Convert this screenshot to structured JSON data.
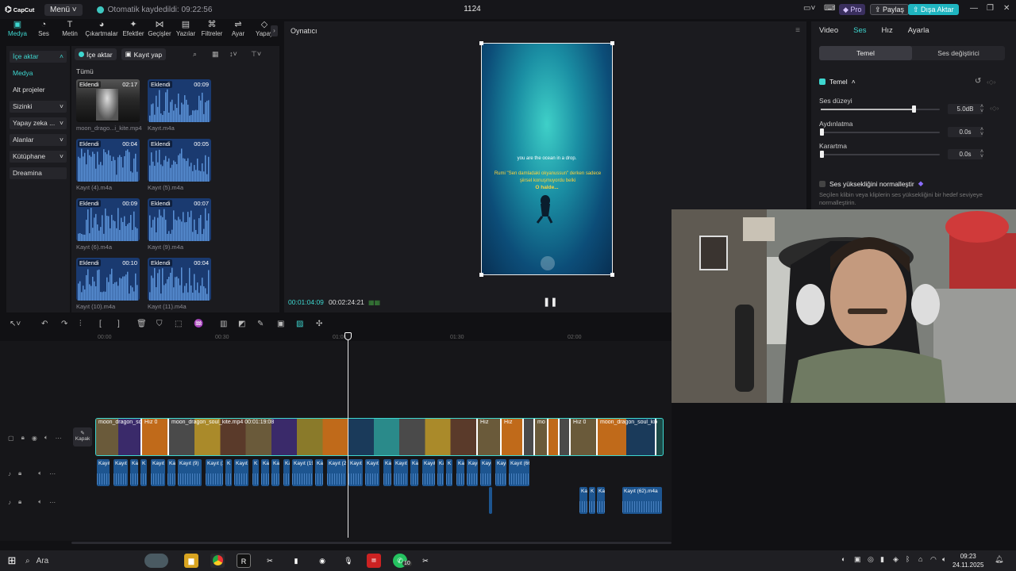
{
  "titlebar": {
    "logo": "CapCut",
    "menu": "Menü",
    "autosave": "Otomatik kaydedildi: 09:22:56",
    "project_title": "1124",
    "pro": "Pro",
    "share": "Paylaş",
    "export": "Dışa Aktar"
  },
  "tool_tabs": [
    {
      "label": "Medya",
      "icon": "▣"
    },
    {
      "label": "Ses",
      "icon": "◔"
    },
    {
      "label": "Metin",
      "icon": "T"
    },
    {
      "label": "Çıkartmalar",
      "icon": "◕"
    },
    {
      "label": "Efektler",
      "icon": "✦"
    },
    {
      "label": "Geçişler",
      "icon": "⋈"
    },
    {
      "label": "Yazılar",
      "icon": "▤"
    },
    {
      "label": "Filtreler",
      "icon": "⌘"
    },
    {
      "label": "Ayar",
      "icon": "⇌"
    },
    {
      "label": "Yapay",
      "icon": "◇"
    }
  ],
  "left_nav": [
    {
      "label": "İçe aktar",
      "type": "active-sec",
      "chev": "˄"
    },
    {
      "label": "Medya",
      "type": "active",
      "chev": ""
    },
    {
      "label": "Alt projeler",
      "type": "plain",
      "chev": ""
    },
    {
      "label": "Sizinki",
      "type": "section",
      "chev": "˅"
    },
    {
      "label": "Yapay zeka ...",
      "type": "section",
      "chev": "˅"
    },
    {
      "label": "Alanlar",
      "type": "section",
      "chev": "˅"
    },
    {
      "label": "Kütüphane",
      "type": "section",
      "chev": "˅"
    },
    {
      "label": "Dreamina",
      "type": "section",
      "chev": ""
    }
  ],
  "media": {
    "import_btn": "İçe aktar",
    "record_btn": "Kayıt yap",
    "all_label": "Tümü",
    "items": [
      {
        "badge": "Eklendi",
        "duration": "02:17",
        "name": "moon_drago...i_kite.mp4",
        "kind": "video"
      },
      {
        "badge": "Eklendi",
        "duration": "00:09",
        "name": "Kayıt.m4a",
        "kind": "audio"
      },
      {
        "badge": "Eklendi",
        "duration": "00:04",
        "name": "Kayıt (4).m4a",
        "kind": "audio"
      },
      {
        "badge": "Eklendi",
        "duration": "00:05",
        "name": "Kayıt (5).m4a",
        "kind": "audio"
      },
      {
        "badge": "Eklendi",
        "duration": "00:09",
        "name": "Kayıt (6).m4a",
        "kind": "audio"
      },
      {
        "badge": "Eklendi",
        "duration": "00:07",
        "name": "Kayıt (9).m4a",
        "kind": "audio"
      },
      {
        "badge": "Eklendi",
        "duration": "00:10",
        "name": "Kayıt (10).m4a",
        "kind": "audio"
      },
      {
        "badge": "Eklendi",
        "duration": "00:04",
        "name": "Kayıt (11).m4a",
        "kind": "audio"
      }
    ]
  },
  "player": {
    "title": "Oynatıcı",
    "caption1": "you are the ocean in a drop.",
    "caption2": "Rumi \"Sen damladaki okyanussun\" derken sadece şiirsel konuşmuyordu belki",
    "caption3": "O halde...",
    "current_time": "00:01:04:09",
    "total_time": "00:02:24:21"
  },
  "right_panel": {
    "tabs": [
      "Video",
      "Ses",
      "Hız",
      "Ayarla"
    ],
    "active_tab": "Ses",
    "segments": [
      "Temel",
      "Ses değiştirici"
    ],
    "section_title": "Temel",
    "volume_label": "Ses düzeyi",
    "volume_value": "5.0dB",
    "fadein_label": "Aydınlatma",
    "fadein_value": "0.0s",
    "fadeout_label": "Karartma",
    "fadeout_value": "0.0s",
    "normalize_label": "Ses yüksekliğini normalleştir",
    "normalize_desc": "Seçilen klibin veya kliplerin ses yüksekliğini bir hedef seviyeye normalleştirin.",
    "volume_level": 0.78
  },
  "timeline": {
    "ruler_ticks": [
      "00:00",
      "00:30",
      "01:00",
      "01:30",
      "02:00"
    ],
    "cover_label": "Kapak",
    "video_clips": [
      {
        "label": "moon_dragon_sou",
        "w": 58
      },
      {
        "label": "Hız 0",
        "w": 34
      },
      {
        "label": "moon_dragon_soul_kite.mp4   00:01:19:08",
        "w": 389
      },
      {
        "label": "Hız",
        "w": 30
      },
      {
        "label": "Hız",
        "w": 28
      },
      {
        "label": "",
        "w": 14
      },
      {
        "label": "mo",
        "w": 17
      },
      {
        "label": "",
        "w": 14
      },
      {
        "label": "",
        "w": 14
      },
      {
        "label": "Hız 0",
        "w": 34
      },
      {
        "label": "moon_dragon_soul_kite",
        "w": 74
      }
    ],
    "audio_row1": [
      "Kayıt",
      "Kayıt",
      "Ka",
      "K",
      "Kayıt",
      "Ka",
      "Kayıt (9)",
      "Kayıt (1",
      "K",
      "Kayıt",
      "K",
      "Ka",
      "Ka",
      "Ka",
      "Kayıt (19",
      "Ka",
      "Kayıt (2",
      "Kayıt",
      "Kayıt",
      "Ka",
      "Kayıt",
      "Ka",
      "Kayıt",
      "Ka",
      "K",
      "Ka",
      "Kayıt",
      "Kayıt",
      "Kayıt",
      "Kayıt (66"
    ],
    "audio_row2": [
      "Ka",
      "K",
      "Ka",
      "Kayıt (62).m4a"
    ]
  },
  "taskbar": {
    "search": "Ara",
    "time": "09:23",
    "date": "24.11.2025",
    "whatsapp_badge": "10"
  },
  "colors": {
    "accent": "#3ed7d0",
    "audio_clip": "#1d5590",
    "export": "#1fb5c0"
  }
}
